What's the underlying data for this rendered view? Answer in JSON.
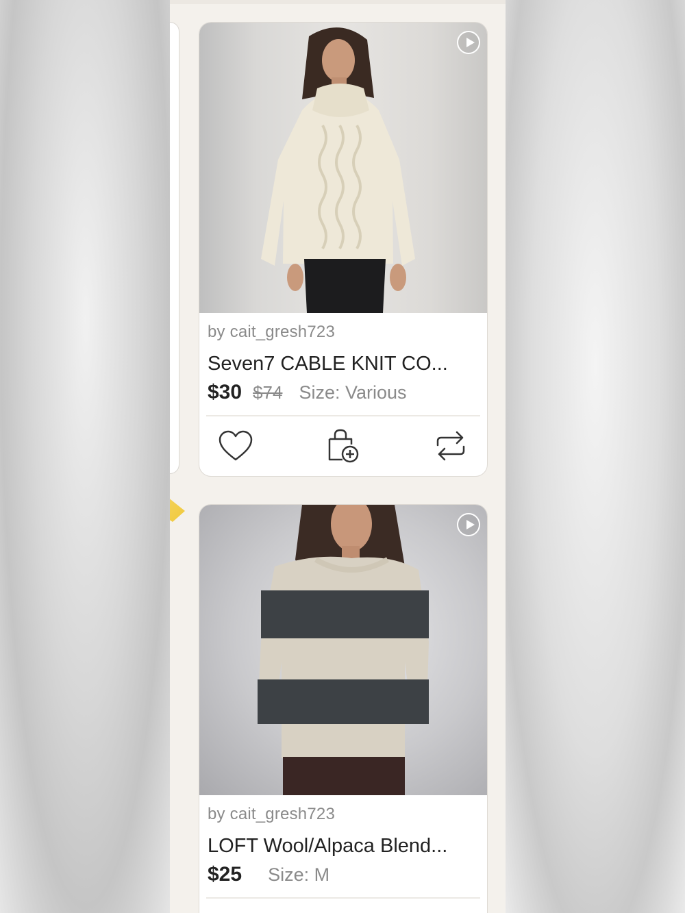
{
  "listings": [
    {
      "seller": "by cait_gresh723",
      "title": "Seven7 CABLE KNIT CO...",
      "price": "$30",
      "original_price": "$74",
      "size": "Size: Various",
      "has_video": true
    },
    {
      "seller": "by cait_gresh723",
      "title": "LOFT Wool/Alpaca Blend...",
      "price": "$25",
      "size": "Size: M",
      "has_video": true
    }
  ],
  "icons": {
    "like": "heart-icon",
    "bundle": "bag-plus-icon",
    "share": "repost-icon",
    "video": "play-circle-icon"
  },
  "colors": {
    "screen_bg": "#f4f1ec",
    "card_bg": "#ffffff",
    "text_primary": "#222222",
    "text_muted": "#8a8a8a"
  }
}
